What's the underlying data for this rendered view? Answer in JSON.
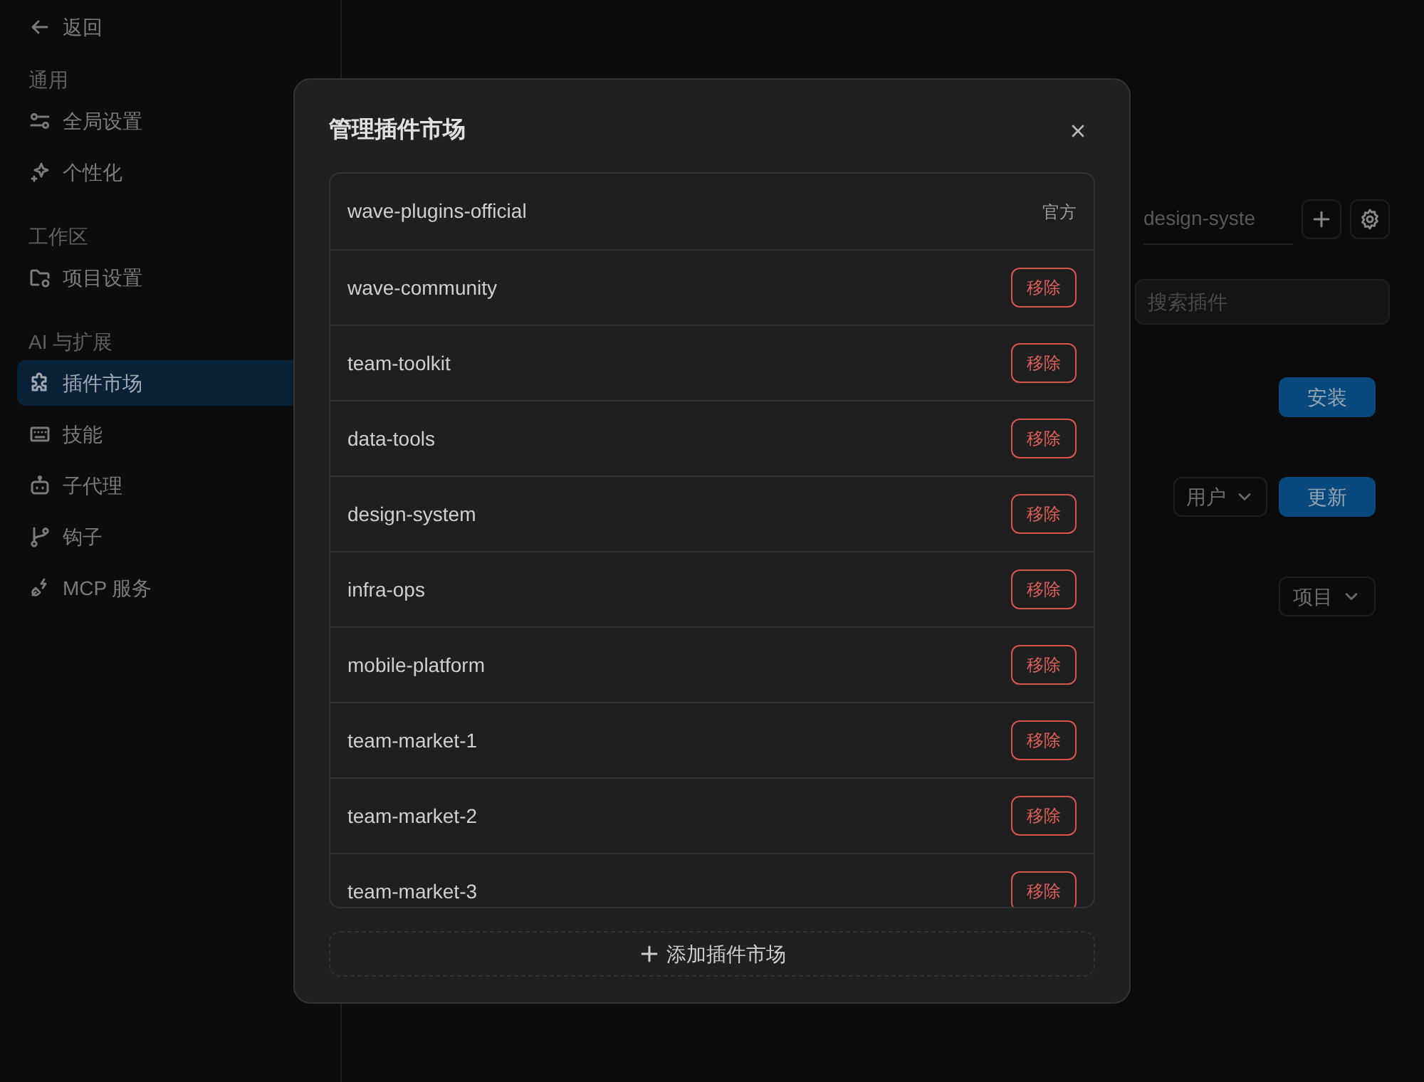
{
  "sidebar": {
    "back": "返回",
    "sections": [
      {
        "title": "通用",
        "items": [
          {
            "label": "全局设置",
            "selected": false
          },
          {
            "label": "个性化",
            "selected": false
          }
        ]
      },
      {
        "title": "工作区",
        "items": [
          {
            "label": "项目设置",
            "selected": false
          }
        ]
      },
      {
        "title": "AI 与扩展",
        "items": [
          {
            "label": "插件市场",
            "selected": true
          },
          {
            "label": "技能",
            "selected": false
          },
          {
            "label": "子代理",
            "selected": false
          },
          {
            "label": "钩子",
            "selected": false
          },
          {
            "label": "MCP 服务",
            "selected": false
          }
        ]
      }
    ]
  },
  "main": {
    "tab": "design-syste",
    "search": {
      "placeholder": "搜索插件"
    },
    "install_button": "安装",
    "scope_user": "用户",
    "update_button": "更新",
    "scope_project": "项目"
  },
  "dialog": {
    "title": "管理插件市场",
    "markets": [
      {
        "name": "wave-plugins-official",
        "kind": "official",
        "tag": "官方"
      },
      {
        "name": "wave-community",
        "kind": "removable",
        "action": "移除"
      },
      {
        "name": "team-toolkit",
        "kind": "removable",
        "action": "移除"
      },
      {
        "name": "data-tools",
        "kind": "removable",
        "action": "移除"
      },
      {
        "name": "design-system",
        "kind": "removable",
        "action": "移除"
      },
      {
        "name": "infra-ops",
        "kind": "removable",
        "action": "移除"
      },
      {
        "name": "mobile-platform",
        "kind": "removable",
        "action": "移除"
      },
      {
        "name": "team-market-1",
        "kind": "removable",
        "action": "移除"
      },
      {
        "name": "team-market-2",
        "kind": "removable",
        "action": "移除"
      },
      {
        "name": "team-market-3",
        "kind": "removable",
        "action": "移除"
      }
    ],
    "add_button": "添加插件市场"
  }
}
